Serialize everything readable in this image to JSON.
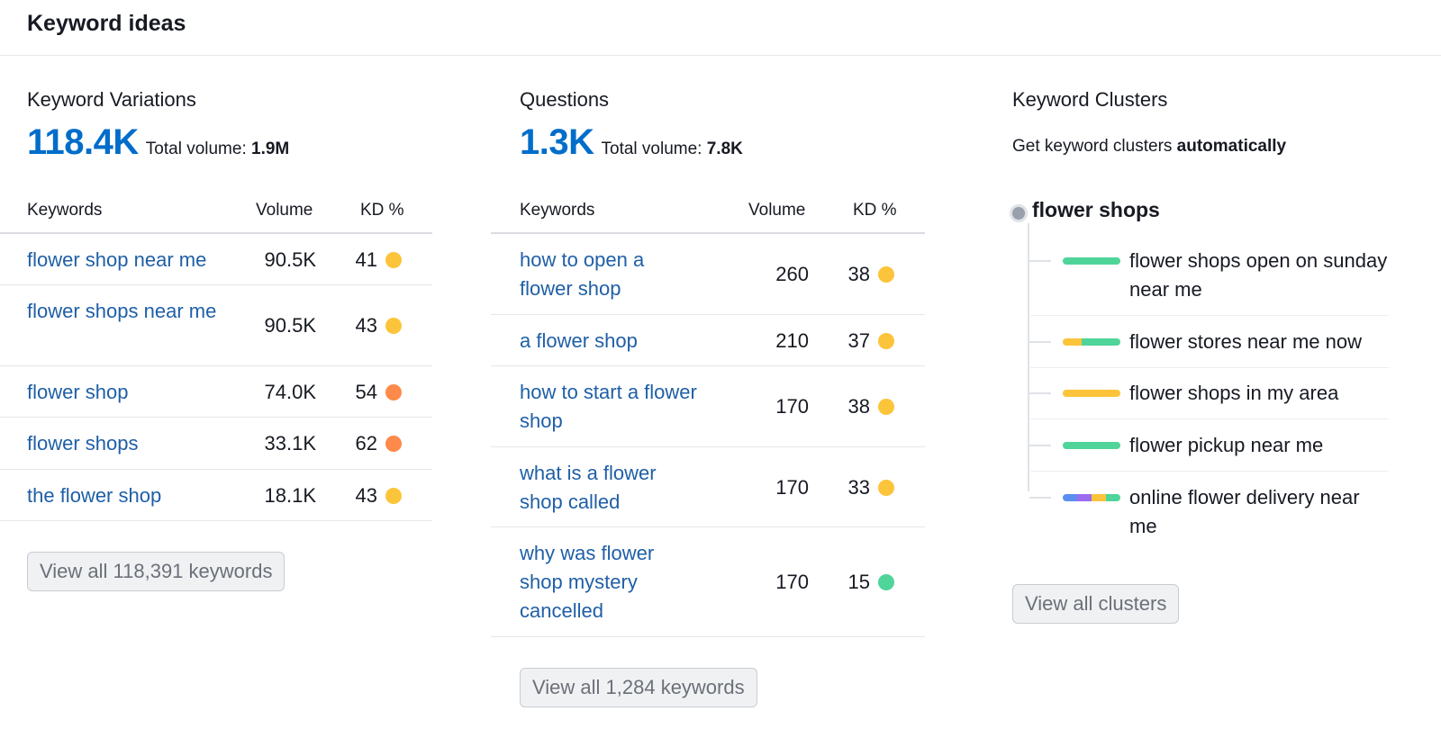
{
  "header": {
    "title": "Keyword ideas"
  },
  "variations": {
    "title": "Keyword Variations",
    "count": "118.4K",
    "total_label": "Total volume:",
    "total_value": "1.9M",
    "col_keywords": "Keywords",
    "col_volume": "Volume",
    "col_kd": "KD %",
    "rows": [
      {
        "keyword": "flower shop near me",
        "volume": "90.5K",
        "kd": "41",
        "kd_color": "#fcc43a"
      },
      {
        "keyword": "flower shops near me",
        "volume": "90.5K",
        "kd": "43",
        "kd_color": "#fcc43a"
      },
      {
        "keyword": "flower shop",
        "volume": "74.0K",
        "kd": "54",
        "kd_color": "#fd8a4a"
      },
      {
        "keyword": "flower shops",
        "volume": "33.1K",
        "kd": "62",
        "kd_color": "#fd8a4a"
      },
      {
        "keyword": "the flower shop",
        "volume": "18.1K",
        "kd": "43",
        "kd_color": "#fcc43a"
      }
    ],
    "button": "View all 118,391 keywords"
  },
  "questions": {
    "title": "Questions",
    "count": "1.3K",
    "total_label": "Total volume:",
    "total_value": "7.8K",
    "col_keywords": "Keywords",
    "col_volume": "Volume",
    "col_kd": "KD %",
    "rows": [
      {
        "keyword": "how to open a flower shop",
        "volume": "260",
        "kd": "38",
        "kd_color": "#fcc43a"
      },
      {
        "keyword": "a flower shop",
        "volume": "210",
        "kd": "37",
        "kd_color": "#fcc43a"
      },
      {
        "keyword": "how to start a flower shop",
        "volume": "170",
        "kd": "38",
        "kd_color": "#fcc43a"
      },
      {
        "keyword": "what is a flower shop called",
        "volume": "170",
        "kd": "33",
        "kd_color": "#fcc43a"
      },
      {
        "keyword": "why was flower shop mystery cancelled",
        "volume": "170",
        "kd": "15",
        "kd_color": "#4fd49a"
      }
    ],
    "button": "View all 1,284 keywords"
  },
  "clusters": {
    "title": "Keyword Clusters",
    "subtitle_prefix": "Get keyword clusters ",
    "subtitle_bold": "automatically",
    "root": "flower shops",
    "items": [
      {
        "label": "flower shops open on sunday near me",
        "bar": [
          "#4fd49a"
        ]
      },
      {
        "label": "flower stores near me now",
        "bar": [
          "#fcc43a",
          "#4fd49a",
          "#4fd49a"
        ]
      },
      {
        "label": "flower shops in my area",
        "bar": [
          "#fcc43a"
        ]
      },
      {
        "label": "flower pickup near me",
        "bar": [
          "#4fd49a"
        ]
      },
      {
        "label": "online flower delivery near me",
        "bar": [
          "#5b8def",
          "#9b6cf0",
          "#fcc43a",
          "#4fd49a"
        ]
      }
    ],
    "button": "View all clusters"
  }
}
